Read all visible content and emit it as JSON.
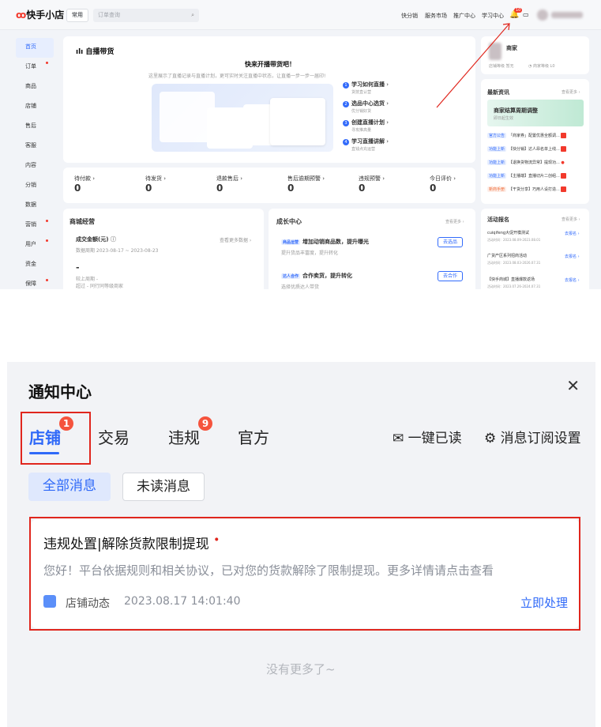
{
  "header": {
    "logo": "快手小店",
    "common_btn": "常用",
    "search_placeholder": "订单查询",
    "nav": [
      "快分销",
      "服务市场",
      "推广中心",
      "学习中心"
    ],
    "bell_count": "10"
  },
  "sidebar": [
    {
      "label": "首页",
      "active": true,
      "dot": false
    },
    {
      "label": "订单",
      "dot": true
    },
    {
      "label": "商品",
      "dot": false
    },
    {
      "label": "店铺",
      "dot": false
    },
    {
      "label": "售后",
      "dot": false
    },
    {
      "label": "客服",
      "dot": false
    },
    {
      "label": "内容",
      "dot": false
    },
    {
      "label": "分销",
      "dot": false
    },
    {
      "label": "数据",
      "dot": false
    },
    {
      "label": "营销",
      "dot": true
    },
    {
      "label": "用户",
      "dot": true
    },
    {
      "label": "资金",
      "dot": false
    },
    {
      "label": "保障",
      "dot": true
    }
  ],
  "hero": {
    "title": "自播带货",
    "headline": "快来开播带货吧！",
    "desc": "这里展示了直播记录与直播计划，更可实时关注直播中状态，让直播一步一步一届印!",
    "steps": [
      {
        "n": "1",
        "title": "学习如何直播",
        "sub": "货技直认营"
      },
      {
        "n": "2",
        "title": "选品中心选货",
        "sub": "优分销好货"
      },
      {
        "n": "3",
        "title": "创建直播计划",
        "sub": "寻攻推高量"
      },
      {
        "n": "4",
        "title": "学习直播讲解",
        "sub": "直钱点充运营"
      }
    ]
  },
  "stats": [
    {
      "label": "待付款",
      "value": "0"
    },
    {
      "label": "待发货",
      "value": "0"
    },
    {
      "label": "退款售后",
      "value": "0"
    },
    {
      "label": "售后逾期预警",
      "value": "0"
    },
    {
      "label": "违规预警",
      "value": "0"
    },
    {
      "label": "今日评价",
      "value": "0"
    }
  ],
  "biz": {
    "title": "商城经营",
    "metric": "成交金额(元)",
    "more": "查看更多数据",
    "date": "数据周期 2023-08-17 ~ 2023-08-23",
    "value": "-",
    "compare1": "较上周期 -",
    "compare2": "超过 - 同行同等级商家"
  },
  "growth": {
    "title": "成长中心",
    "more": "查看更多",
    "items": [
      {
        "tag": "商品运营",
        "title": "增加动销商品数，提升曝光",
        "sub": "提升货品丰富度，提升转化",
        "btn": "去选品"
      },
      {
        "tag": "达人合作",
        "title": "合作卖货，提升转化",
        "sub": "选择优质达人带货",
        "btn": "去合作"
      }
    ]
  },
  "profile": {
    "name": "商家",
    "meta": "店铺等级 暂无",
    "level": "商家等级 L0"
  },
  "news": {
    "title": "最新资讯",
    "more": "查看更多",
    "banner": "商家结算周期调整",
    "banner_sub": "即日起生效",
    "items": [
      {
        "tag": "官方公告",
        "text": "「商家券」配置优惠全额调..."
      },
      {
        "tag": "功能上新",
        "text": "【快分销】达人昂名单上线..."
      },
      {
        "tag": "功能上新",
        "text": "【退换货物流异常】提现功..."
      },
      {
        "tag": "功能上新",
        "text": "【主播端】直播切片二创组..."
      },
      {
        "tag": "新商手册",
        "text": "【干货分享】巧用人设打造..."
      }
    ]
  },
  "events": {
    "title": "活动报名",
    "more": "查看更多",
    "items": [
      {
        "title": "cuiqifeng大促开模测试",
        "date": "活动时间：2023.08.09-2023.08.01",
        "btn": "去报名"
      },
      {
        "title": "广货产区系列招商活动",
        "date": "活动时间：2023.08.03-2026.07.31",
        "btn": "去报名"
      },
      {
        "title": "【快手商城】直播爆款返场",
        "date": "活动时间：2023.07.26-2024.07.31",
        "btn": "去报名"
      }
    ]
  },
  "notify": {
    "title": "通知中心",
    "tabs": [
      {
        "label": "店铺",
        "badge": "1"
      },
      {
        "label": "交易",
        "badge": ""
      },
      {
        "label": "违规",
        "badge": "9"
      },
      {
        "label": "官方",
        "badge": ""
      }
    ],
    "mark_read": "一键已读",
    "subscribe": "消息订阅设置",
    "filters": [
      "全部消息",
      "未读消息"
    ],
    "message": {
      "title": "违规处置|解除货款限制提现",
      "body": "您好！平台依据规则和相关协议，已对您的货款解除了限制提现。更多详情请点击查看",
      "source": "店铺动态",
      "time": "2023.08.17 14:01:40",
      "action": "立即处理"
    },
    "end": "没有更多了~"
  }
}
